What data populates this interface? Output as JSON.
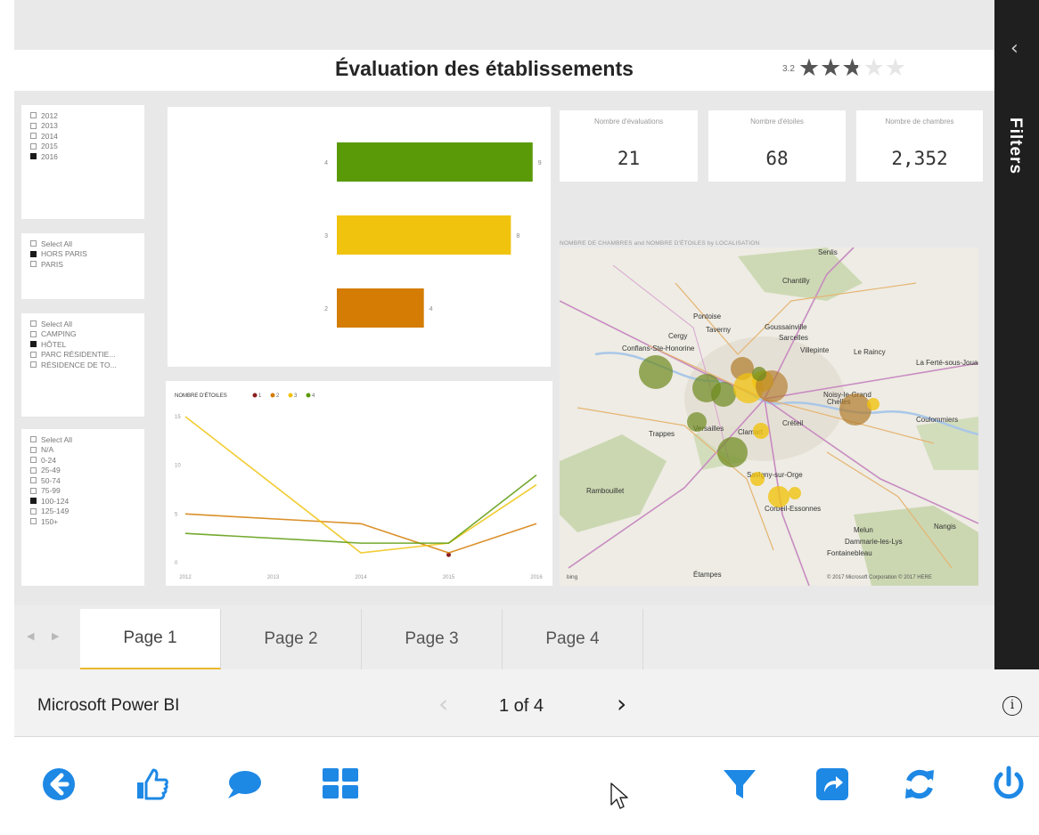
{
  "report": {
    "title": "Évaluation des établissements",
    "rating_value": "3.2",
    "rating_score": 3.2,
    "rating_max": 5
  },
  "filters_pane": {
    "label": "Filters"
  },
  "slicers": [
    {
      "items": [
        {
          "label": "2012",
          "checked": false
        },
        {
          "label": "2013",
          "checked": false
        },
        {
          "label": "2014",
          "checked": false
        },
        {
          "label": "2015",
          "checked": false
        },
        {
          "label": "2016",
          "checked": true
        }
      ]
    },
    {
      "items": [
        {
          "label": "Select All",
          "checked": false
        },
        {
          "label": "HORS PARIS",
          "checked": true
        },
        {
          "label": "PARIS",
          "checked": false
        }
      ]
    },
    {
      "items": [
        {
          "label": "Select All",
          "checked": false
        },
        {
          "label": "CAMPING",
          "checked": false
        },
        {
          "label": "HÔTEL",
          "checked": true
        },
        {
          "label": "PARC RÉSIDENTIE...",
          "checked": false
        },
        {
          "label": "RÉSIDENCE DE TO...",
          "checked": false
        }
      ]
    },
    {
      "items": [
        {
          "label": "Select All",
          "checked": false
        },
        {
          "label": "N/A",
          "checked": false
        },
        {
          "label": "0-24",
          "checked": false
        },
        {
          "label": "25-49",
          "checked": false
        },
        {
          "label": "50-74",
          "checked": false
        },
        {
          "label": "75-99",
          "checked": false
        },
        {
          "label": "100-124",
          "checked": true
        },
        {
          "label": "125-149",
          "checked": false
        },
        {
          "label": "150+",
          "checked": false
        }
      ]
    }
  ],
  "kpis": [
    {
      "label": "Nombre d'évaluations",
      "value": "21"
    },
    {
      "label": "Nombre d'étoiles",
      "value": "68"
    },
    {
      "label": "Nombre de chambres",
      "value": "2,352"
    }
  ],
  "map": {
    "caption": "NOMBRE DE CHAMBRES and NOMBRE D'ÉTOILES by LOCALISATION",
    "places": [
      "Senlis",
      "Chantilly",
      "Pontoise",
      "Taverny",
      "Goussainville",
      "Cergy",
      "Sarcelles",
      "Conflans-Ste-Honorine",
      "Villepinte",
      "Le Raincy",
      "La Ferté-sous-Jouarre",
      "Chelles",
      "Noisy-le-Grand",
      "Coulommiers",
      "Trappes",
      "Versailles",
      "Clamart",
      "Créteil",
      "Rambouillet",
      "Savigny-sur-Orge",
      "Corbeil-Essonnes",
      "Nangis",
      "Melun",
      "Dammarie-les-Lys",
      "Étampes",
      "Fontainebleau"
    ],
    "copyright": "© 2017 Microsoft Corporation © 2017 HERE",
    "brand": "bing"
  },
  "tabs": [
    {
      "label": "Page 1",
      "active": true
    },
    {
      "label": "Page 2",
      "active": false
    },
    {
      "label": "Page 3",
      "active": false
    },
    {
      "label": "Page 4",
      "active": false
    }
  ],
  "status": {
    "app_name": "Microsoft Power BI",
    "pager": "1 of  4"
  },
  "colors": {
    "accent_blue": "#1e88e5",
    "star_4": "#5a9a08",
    "star_3": "#f0c30f",
    "star_2": "#d47c04",
    "star_1": "#8b1e1e"
  },
  "toolbar_icons": [
    "back-icon",
    "like-icon",
    "comment-icon",
    "grid-icon",
    "filter-icon",
    "share-icon",
    "refresh-icon",
    "power-icon"
  ],
  "chart_data": [
    {
      "type": "bar",
      "orientation": "horizontal",
      "categories": [
        "4",
        "3",
        "2"
      ],
      "values": [
        9,
        8,
        4
      ],
      "colors": [
        "#5a9a08",
        "#f0c30f",
        "#d47c04"
      ],
      "xlim": [
        0,
        10
      ]
    },
    {
      "type": "line",
      "legend_title": "NOMBRE D'ÉTOILES",
      "legend_position": "top-left",
      "x": [
        "2012",
        "2013",
        "2014",
        "2015",
        "2016"
      ],
      "yticks": [
        "0",
        "5",
        "10",
        "15"
      ],
      "ylim": [
        0,
        15
      ],
      "series": [
        {
          "name": "1",
          "color": "#8b1e1e",
          "values": [
            null,
            null,
            null,
            0.8,
            null
          ]
        },
        {
          "name": "2",
          "color": "#d47c04",
          "values": [
            5,
            null,
            4,
            1,
            4
          ]
        },
        {
          "name": "3",
          "color": "#f0c30f",
          "values": [
            15,
            null,
            1,
            2,
            8
          ]
        },
        {
          "name": "4",
          "color": "#5a9a08",
          "values": [
            3,
            null,
            2,
            2,
            9
          ]
        }
      ]
    },
    {
      "type": "scatter",
      "description": "bubble map",
      "series": [
        {
          "name": "4",
          "color": "#5a9a08"
        },
        {
          "name": "3",
          "color": "#f0c30f"
        },
        {
          "name": "2",
          "color": "#d47c04"
        }
      ]
    }
  ]
}
